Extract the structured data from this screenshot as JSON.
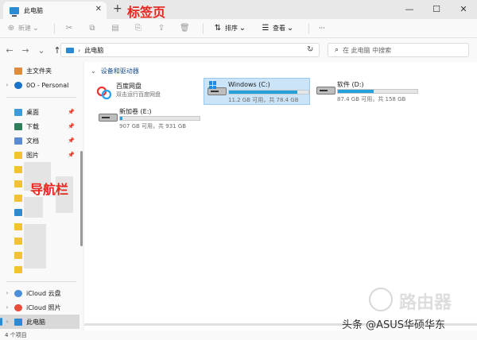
{
  "tab": {
    "title": "此电脑",
    "close": "✕",
    "new": "+"
  },
  "annotations": {
    "tab_label": "标签页",
    "nav_label": "导航栏"
  },
  "window": {
    "minimize": "—",
    "maximize": "☐",
    "close": "✕"
  },
  "toolbar": {
    "new_label": "新建",
    "sort_label": "排序",
    "view_label": "查看",
    "more_label": "···"
  },
  "address": {
    "crumb": "此电脑",
    "search_placeholder": "在 此电脑 中搜索"
  },
  "sidebar": {
    "items": [
      {
        "label": "主文件夹"
      },
      {
        "label": "0O - Personal"
      },
      {
        "label": "桌面"
      },
      {
        "label": "下载"
      },
      {
        "label": "文档"
      },
      {
        "label": "图片"
      },
      {
        "label": "iCloud 云盘"
      },
      {
        "label": "iCloud 照片"
      },
      {
        "label": "此电脑"
      }
    ]
  },
  "main": {
    "group_title": "设备和驱动器",
    "baidu": {
      "name": "百度网盘",
      "subtitle": "双击运行百度网盘"
    },
    "drives": [
      {
        "name": "Windows (C:)",
        "info": "11.2 GB 可用，共 78.4 GB",
        "used_fraction": 0.86
      },
      {
        "name": "软件 (D:)",
        "info": "87.4 GB 可用，共 158 GB",
        "used_fraction": 0.45
      },
      {
        "name": "新加卷 (E:)",
        "info": "907 GB 可用，共 931 GB",
        "used_fraction": 0.03
      }
    ]
  },
  "status": {
    "count": "4 个项目"
  },
  "watermark": {
    "logo_text": "路由器",
    "credit": "头条 @ASUS华硕华东"
  },
  "colors": {
    "accent": "#26a0da",
    "annotation": "#e8261e",
    "folder": "#f2c230"
  }
}
